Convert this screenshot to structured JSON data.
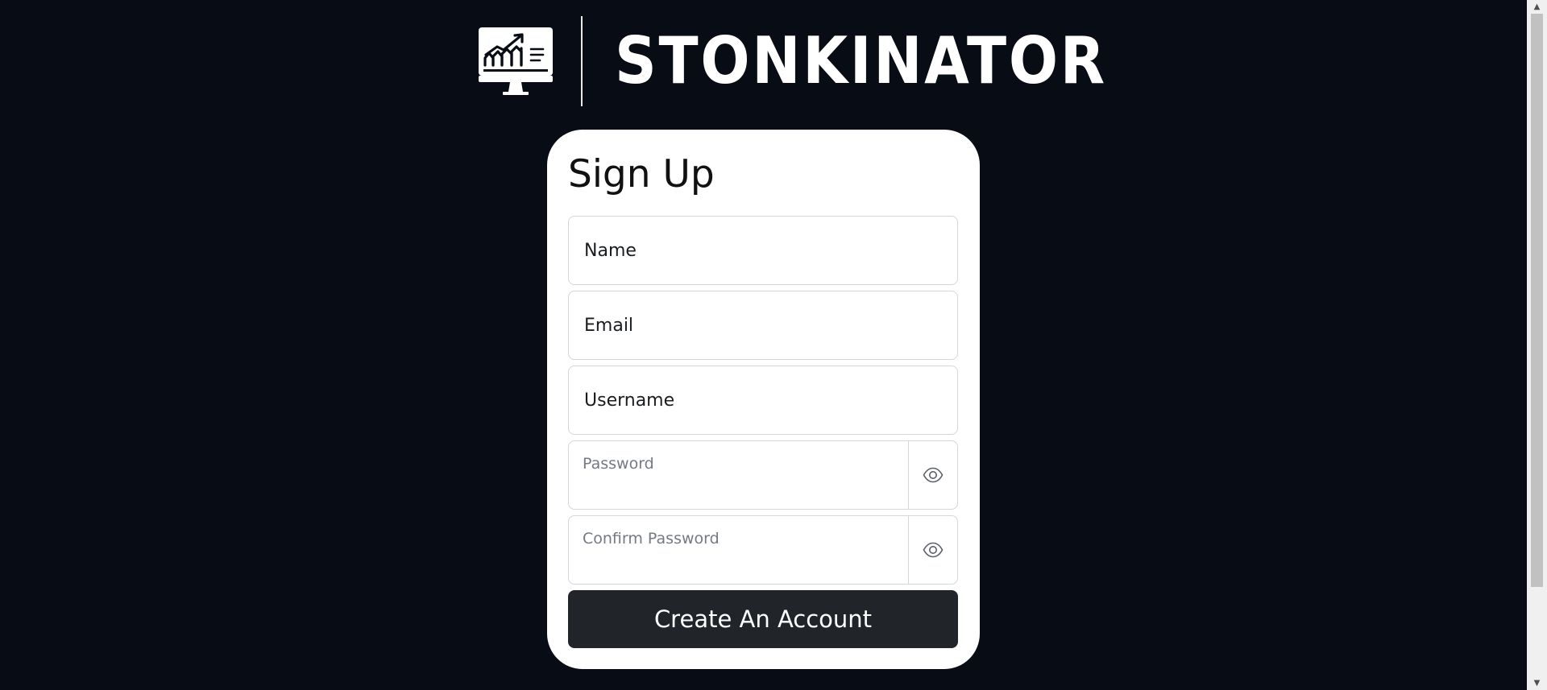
{
  "header": {
    "brand_name": "STONKINATOR",
    "logo_icon": "monitor-chart-icon"
  },
  "form": {
    "title": "Sign Up",
    "name_placeholder": "Name",
    "email_placeholder": "Email",
    "username_placeholder": "Username",
    "password_label": "Password",
    "confirm_password_label": "Confirm Password",
    "toggle_icon": "eye-icon",
    "submit_label": "Create An Account"
  },
  "colors": {
    "background": "#070c15",
    "card": "#ffffff",
    "button": "#212529"
  }
}
